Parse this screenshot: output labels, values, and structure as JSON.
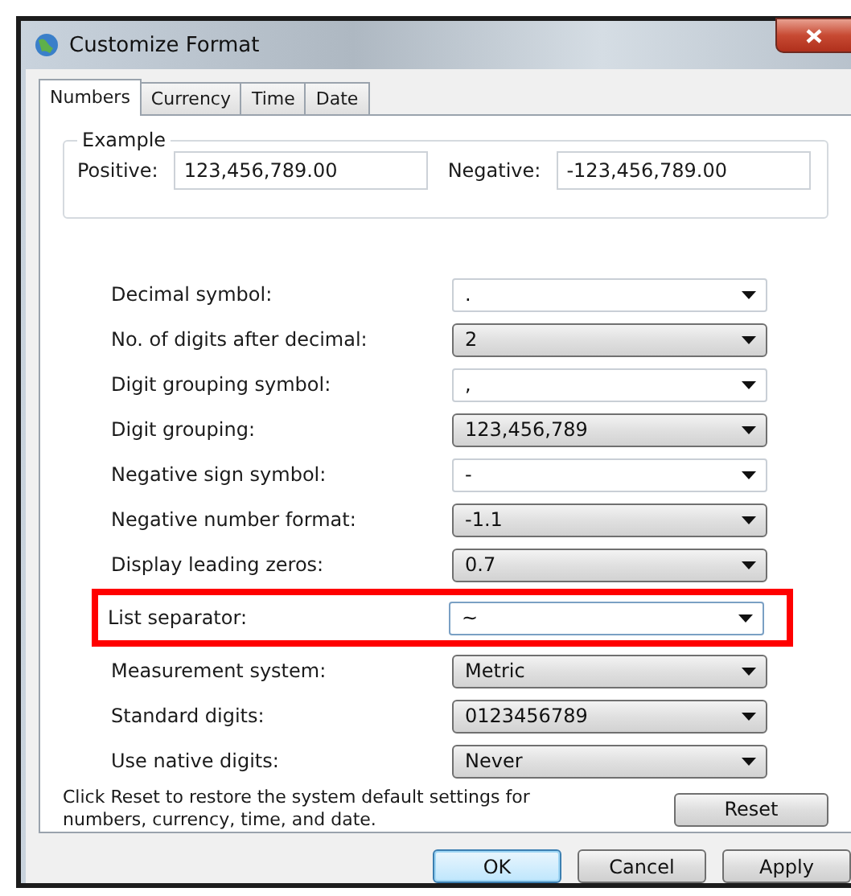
{
  "window": {
    "title": "Customize Format"
  },
  "tabs": [
    {
      "label": "Numbers",
      "selected": true
    },
    {
      "label": "Currency",
      "selected": false
    },
    {
      "label": "Time",
      "selected": false
    },
    {
      "label": "Date",
      "selected": false
    }
  ],
  "example": {
    "title": "Example",
    "positive_label": "Positive:",
    "positive_value": "123,456,789.00",
    "negative_label": "Negative:",
    "negative_value": "-123,456,789.00"
  },
  "settings": [
    {
      "label": "Decimal symbol:",
      "value": ".",
      "kind": "editable",
      "highlighted": false
    },
    {
      "label": "No. of digits after decimal:",
      "value": "2",
      "kind": "list",
      "highlighted": false
    },
    {
      "label": "Digit grouping symbol:",
      "value": ",",
      "kind": "editable",
      "highlighted": false
    },
    {
      "label": "Digit grouping:",
      "value": "123,456,789",
      "kind": "list",
      "highlighted": false
    },
    {
      "label": "Negative sign symbol:",
      "value": "-",
      "kind": "editable",
      "highlighted": false
    },
    {
      "label": "Negative number format:",
      "value": "-1.1",
      "kind": "list",
      "highlighted": false
    },
    {
      "label": "Display leading zeros:",
      "value": "0.7",
      "kind": "list",
      "highlighted": false
    },
    {
      "label": "List separator:",
      "value": "~",
      "kind": "editable",
      "highlighted": true
    },
    {
      "label": "Measurement system:",
      "value": "Metric",
      "kind": "list",
      "highlighted": false
    },
    {
      "label": "Standard digits:",
      "value": "0123456789",
      "kind": "list",
      "highlighted": false
    },
    {
      "label": "Use native digits:",
      "value": "Never",
      "kind": "list",
      "highlighted": false
    }
  ],
  "reset_note": "Click Reset to restore the system default settings for numbers, currency, time, and date.",
  "reset_button": "Reset",
  "buttons": [
    {
      "label": "OK",
      "default": true
    },
    {
      "label": "Cancel",
      "default": false
    },
    {
      "label": "Apply",
      "default": false
    }
  ]
}
